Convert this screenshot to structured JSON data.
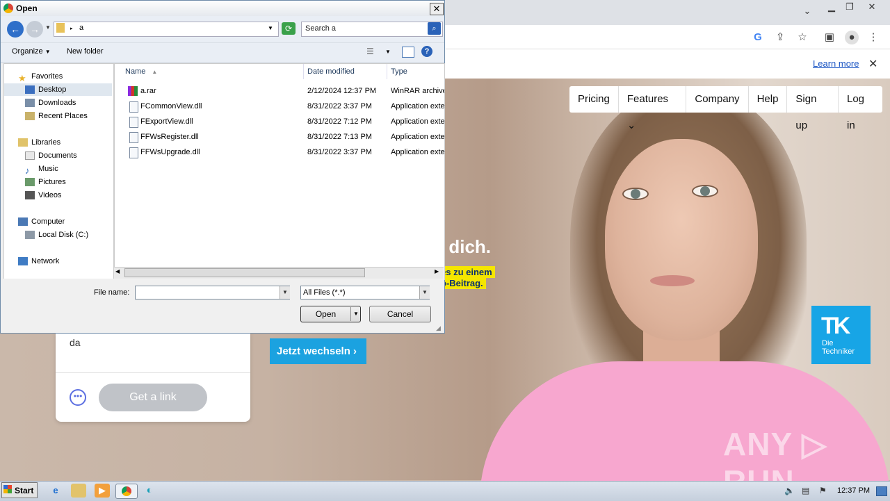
{
  "browser": {
    "info_link": "Learn more",
    "nav_items": [
      "Pricing",
      "Features",
      "Company",
      "Help",
      "Sign up",
      "Log in"
    ],
    "features_caret": "⌄"
  },
  "page": {
    "headline": "r dich.",
    "yellow_line1": "es zu einem",
    "yellow_line2": "o-Beitrag.",
    "cta_label": "Jetzt wechseln",
    "card_text": "da",
    "get_link_label": "Get a link",
    "logo_mark": "TK",
    "logo_text1": "Die",
    "logo_text2": "Techniker",
    "watermark": "ANY ▷ RUN"
  },
  "dialog": {
    "title": "Open",
    "address": "a",
    "search_placeholder": "Search a",
    "organize_label": "Organize",
    "new_folder_label": "New folder",
    "nav": {
      "favorites": "Favorites",
      "desktop": "Desktop",
      "downloads": "Downloads",
      "recent": "Recent Places",
      "libraries": "Libraries",
      "documents": "Documents",
      "music": "Music",
      "pictures": "Pictures",
      "videos": "Videos",
      "computer": "Computer",
      "local_disk": "Local Disk (C:)",
      "network": "Network"
    },
    "columns": {
      "name": "Name",
      "date": "Date modified",
      "type": "Type"
    },
    "files": [
      {
        "name": "a.rar",
        "date": "2/12/2024 12:37 PM",
        "type": "WinRAR archive"
      },
      {
        "name": "FCommonView.dll",
        "date": "8/31/2022 3:37 PM",
        "type": "Application exte"
      },
      {
        "name": "FExportView.dll",
        "date": "8/31/2022 7:12 PM",
        "type": "Application exte"
      },
      {
        "name": "FFWsRegister.dll",
        "date": "8/31/2022 7:13 PM",
        "type": "Application exte"
      },
      {
        "name": "FFWsUpgrade.dll",
        "date": "8/31/2022 3:37 PM",
        "type": "Application exte"
      }
    ],
    "file_name_label": "File name:",
    "file_name_value": "",
    "file_type": "All Files (*.*)",
    "open_label": "Open",
    "cancel_label": "Cancel"
  },
  "taskbar": {
    "start_label": "Start",
    "clock": "12:37 PM"
  }
}
